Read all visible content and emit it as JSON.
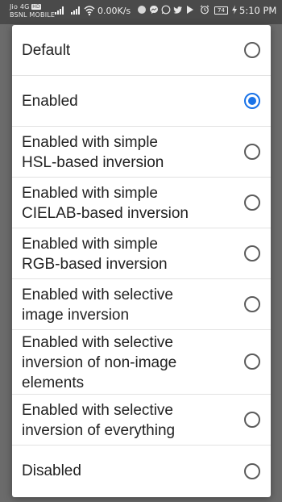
{
  "status_bar": {
    "carrier_line1": "Jio 4G",
    "volte_badge": "HD",
    "carrier_line2": "BSNL MOBILE",
    "net_speed": "0.00K/s",
    "battery_level": "74",
    "time": "5:10 PM",
    "icons": [
      "signal-icon",
      "signal-icon",
      "wifi-icon",
      "circle-icon",
      "messenger-icon",
      "whatsapp-icon",
      "twitter-icon",
      "play-store-icon",
      "alarm-icon",
      "silent-icon",
      "battery-icon",
      "charging-icon"
    ]
  },
  "dialog": {
    "selected_index": 1,
    "accent_color": "#1a73e8",
    "options": [
      {
        "label": "Default",
        "checked": false
      },
      {
        "label": "Enabled",
        "checked": true
      },
      {
        "label": "Enabled with simple\nHSL-based inversion",
        "checked": false
      },
      {
        "label": "Enabled with simple\nCIELAB-based inversion",
        "checked": false
      },
      {
        "label": "Enabled with simple\nRGB-based inversion",
        "checked": false
      },
      {
        "label": "Enabled with selective\nimage inversion",
        "checked": false
      },
      {
        "label": "Enabled with selective\ninversion of non-image\nelements",
        "checked": false
      },
      {
        "label": "Enabled with selective\ninversion of everything",
        "checked": false
      },
      {
        "label": "Disabled",
        "checked": false
      }
    ]
  }
}
